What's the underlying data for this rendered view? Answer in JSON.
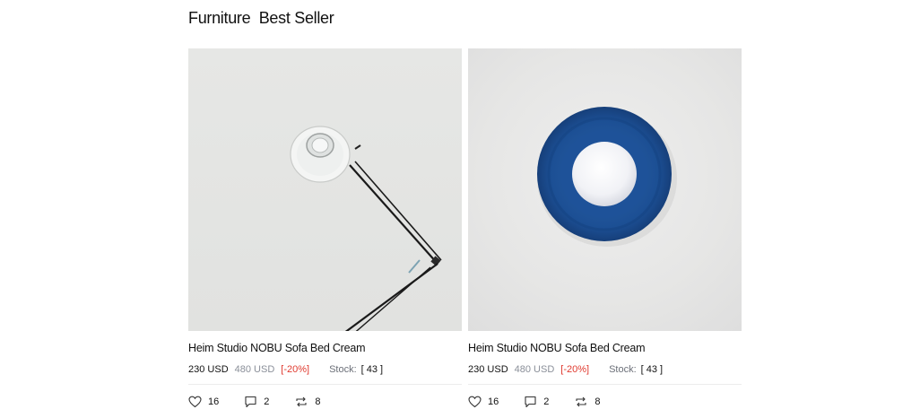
{
  "header": {
    "title": "Furniture  Best Seller"
  },
  "products": [
    {
      "name": "Heim Studio NOBU Sofa Bed Cream",
      "price": "230 USD",
      "old_price": "480 USD",
      "discount": "[-20%]",
      "stock_label": "Stock:",
      "stock_value": "[ 43 ]",
      "likes": "16",
      "comments": "2",
      "shares": "8",
      "image_icon": "desk-lamp-image"
    },
    {
      "name": "Heim Studio NOBU Sofa Bed Cream",
      "price": "230 USD",
      "old_price": "480 USD",
      "discount": "[-20%]",
      "stock_label": "Stock:",
      "stock_value": "[ 43 ]",
      "likes": "16",
      "comments": "2",
      "shares": "8",
      "image_icon": "wall-light-image"
    }
  ],
  "colors": {
    "discount": "#e03a2f",
    "muted": "#8a8f99",
    "lamp_blue": "#1d4f93"
  }
}
